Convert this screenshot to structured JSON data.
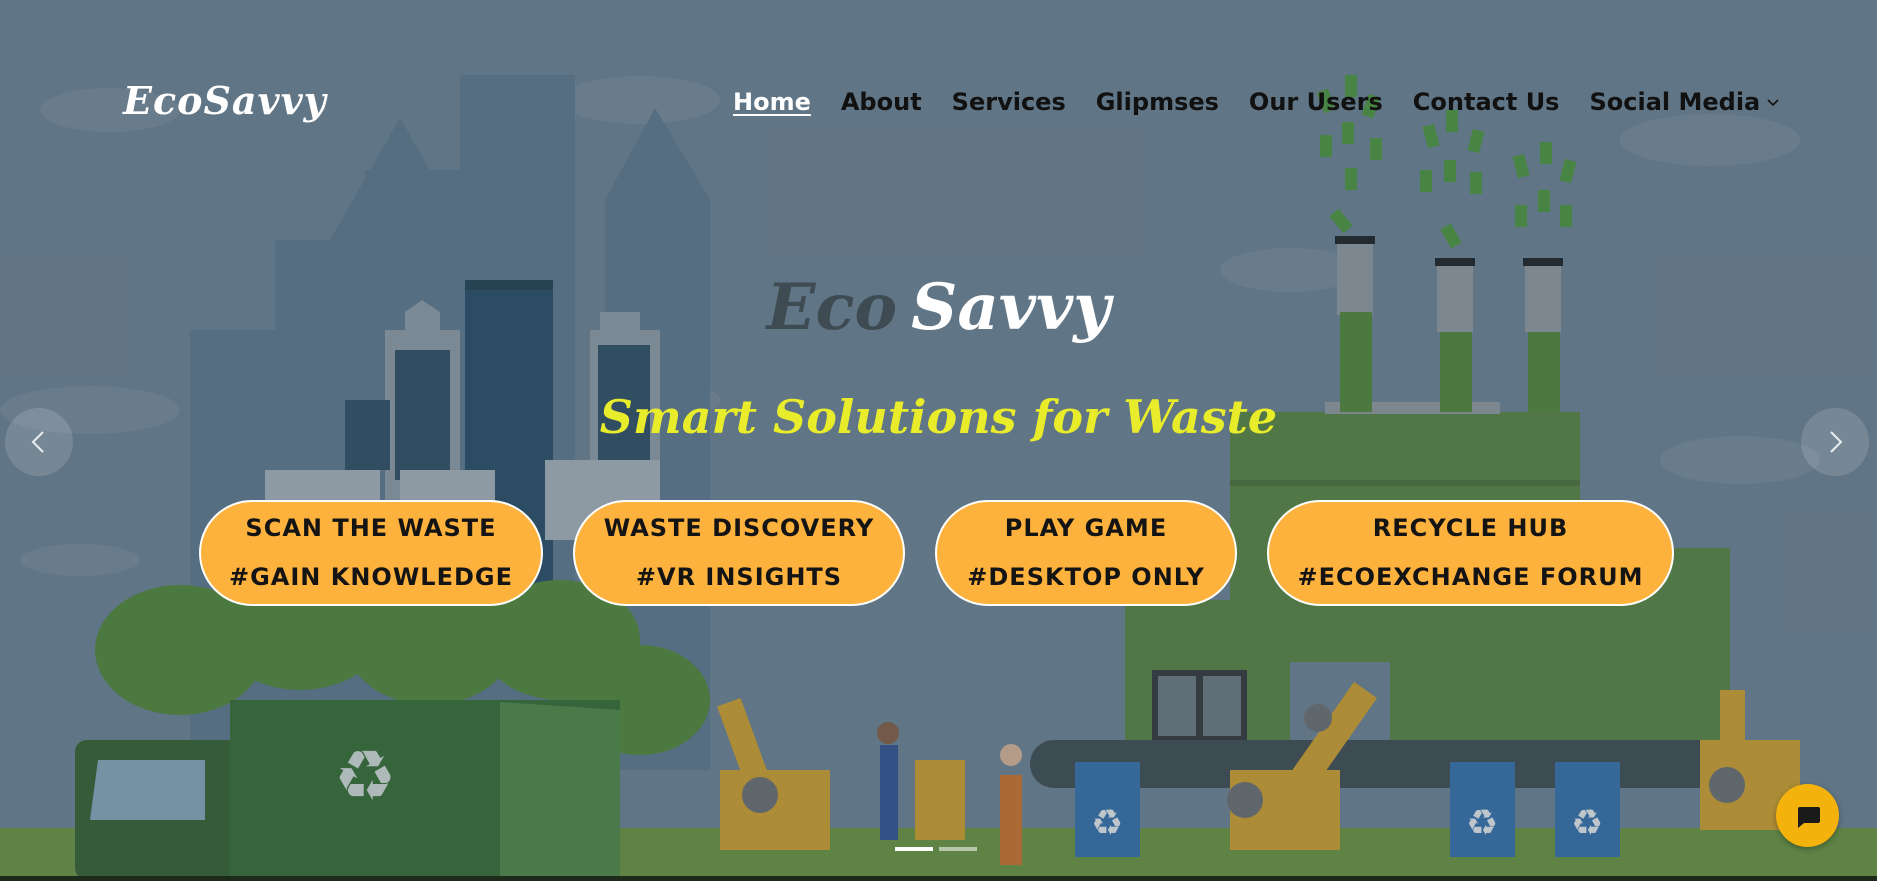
{
  "header": {
    "logo": "EcoSavvy",
    "nav": [
      {
        "label": "Home"
      },
      {
        "label": "About"
      },
      {
        "label": "Services"
      },
      {
        "label": "Glipmses"
      },
      {
        "label": "Our Users"
      },
      {
        "label": "Contact Us"
      },
      {
        "label": "Social Media"
      }
    ]
  },
  "hero": {
    "brand_eco": "Eco",
    "brand_savvy": "Savvy",
    "tagline": "Smart Solutions for Waste",
    "buttons": [
      {
        "line1": "SCAN THE WASTE",
        "line2": "#GAIN KNOWLEDGE"
      },
      {
        "line1": "WASTE DISCOVERY",
        "line2": "#VR INSIGHTS"
      },
      {
        "line1": "PLAY GAME",
        "line2": "#DESKTOP ONLY"
      },
      {
        "line1": "RECYCLE HUB",
        "line2": "#ECOEXCHANGE FORUM"
      }
    ],
    "carousel": {
      "slides": 2,
      "active": 1
    },
    "icons": {
      "prev": "chevron-left-icon",
      "next": "chevron-right-icon",
      "chat": "chat-bubble-icon",
      "dropdown": "chevron-down-icon",
      "recycle": "recycle-icon"
    }
  },
  "colors": {
    "button_bg": "#feb23e",
    "tagline": "#e8ec2b",
    "chat_bg": "#f4b30c",
    "nav_text": "#111111",
    "active_nav": "#ffffff"
  }
}
